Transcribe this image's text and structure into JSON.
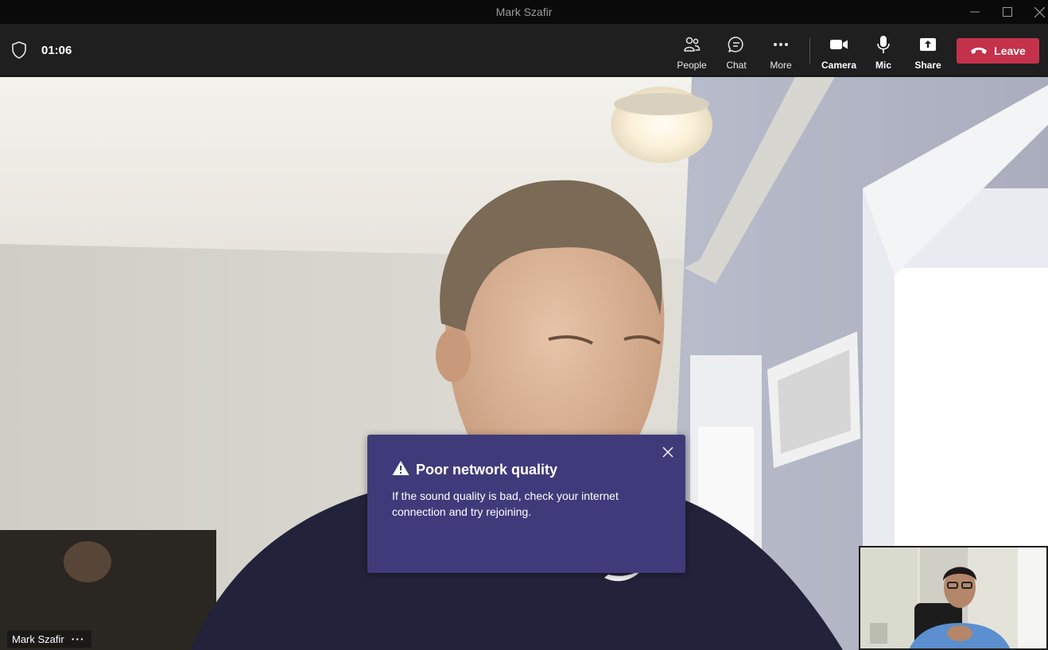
{
  "window": {
    "title": "Mark Szafir",
    "controls": [
      "minimize-icon",
      "maximize-icon",
      "close-icon"
    ]
  },
  "toolbar": {
    "shield_icon": "shield-icon",
    "timer": "01:06",
    "buttons": [
      {
        "id": "people",
        "label": "People",
        "icon": "people-icon"
      },
      {
        "id": "chat",
        "label": "Chat",
        "icon": "chat-icon"
      },
      {
        "id": "more",
        "label": "More",
        "icon": "more-icon"
      },
      {
        "id": "camera",
        "label": "Camera",
        "icon": "camera-icon"
      },
      {
        "id": "mic",
        "label": "Mic",
        "icon": "mic-icon"
      },
      {
        "id": "share",
        "label": "Share",
        "icon": "share-icon"
      }
    ],
    "leave_label": "Leave",
    "leave_color": "#c4314b"
  },
  "notification": {
    "title": "Poor network quality",
    "message": "If the sound quality is bad, check your internet connection and try rejoining.",
    "background": "#3f3b7b"
  },
  "participant": {
    "name": "Mark Szafir",
    "more": "···"
  }
}
